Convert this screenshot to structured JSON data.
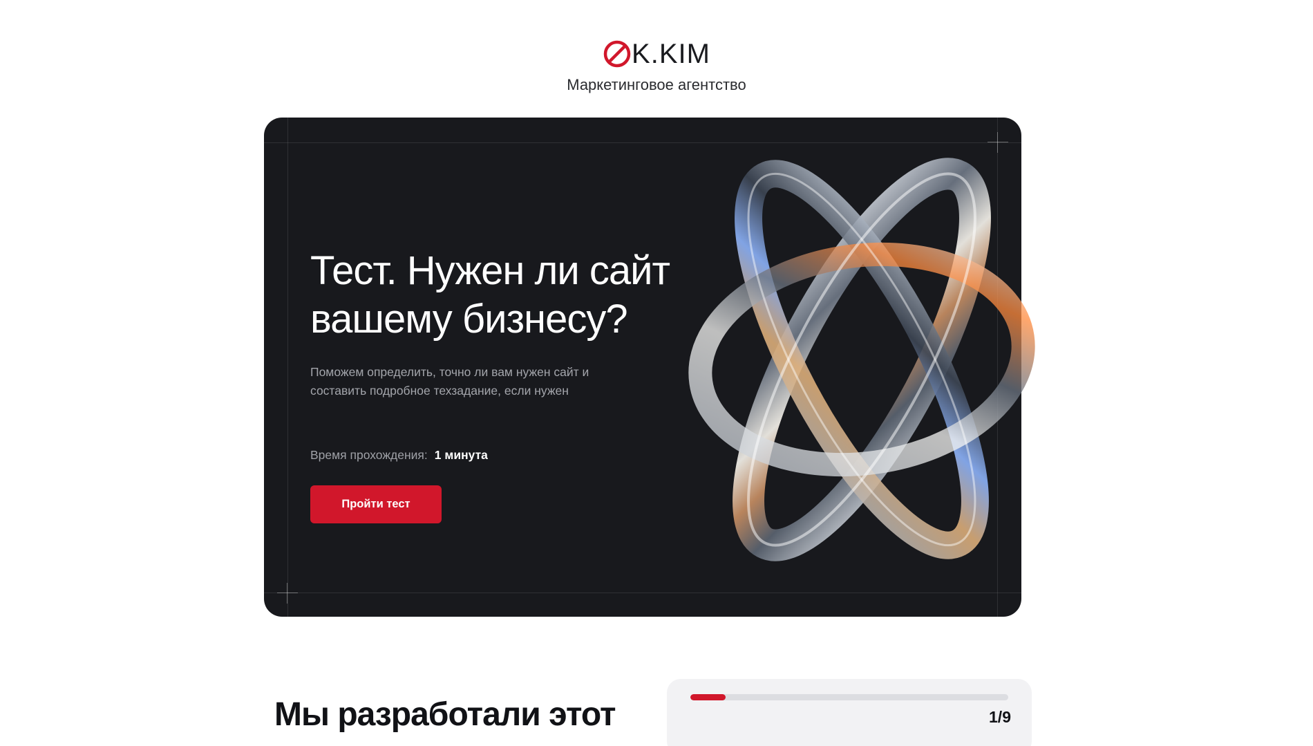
{
  "brand": {
    "logo_text": "K.KIM",
    "tagline": "Маркетинговое агентство",
    "accent_color": "#d1172b"
  },
  "hero": {
    "title": "Тест. Нужен ли сайт вашему бизнесу?",
    "description": "Поможем определить, точно ли вам нужен сайт и составить подробное техзадание, если нужен",
    "time_label": "Время прохождения:",
    "time_value": "1 минута",
    "cta_label": "Пройти тест",
    "background_color": "#18191d"
  },
  "section": {
    "title": "Мы разработали этот"
  },
  "quiz": {
    "progress_fraction": 0.111,
    "counter": "1/9"
  }
}
